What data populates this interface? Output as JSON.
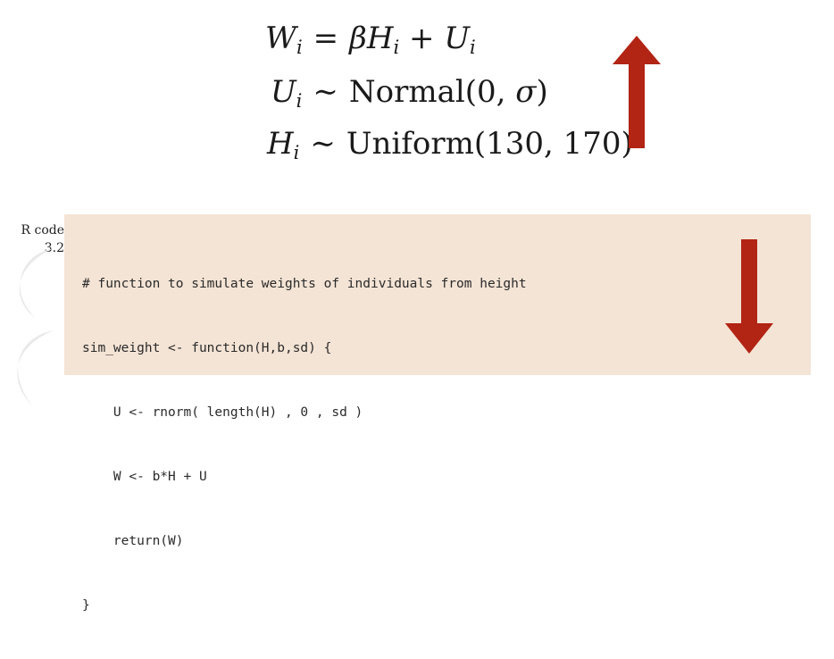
{
  "equations": [
    {
      "lhs": "W",
      "lhs_sub": "i",
      "op": "=",
      "parts": [
        {
          "text": "β",
          "italic": true
        },
        {
          "text": "H",
          "italic": true,
          "sub": "i"
        },
        {
          "text": " + ",
          "italic": false
        },
        {
          "text": "U",
          "italic": true,
          "sub": "i"
        }
      ]
    },
    {
      "lhs": "U",
      "lhs_sub": "i",
      "op": "∼",
      "parts": [
        {
          "text": "Normal(0, ",
          "italic": false
        },
        {
          "text": "σ",
          "italic": true
        },
        {
          "text": ")",
          "italic": false
        }
      ]
    },
    {
      "lhs": "H",
      "lhs_sub": "i",
      "op": "∼",
      "parts": [
        {
          "text": "Uniform(130, 170)",
          "italic": false
        }
      ]
    }
  ],
  "code_label": {
    "line1": "R code",
    "line2": "3.2"
  },
  "code": [
    "# function to simulate weights of individuals from height",
    "sim_weight <- function(H,b,sd) {",
    "    U <- rnorm( length(H) , 0 , sd )",
    "    W <- b*H + U",
    "    return(W)",
    "}"
  ],
  "arrows": {
    "up": {
      "direction": "up",
      "color": "#b22414"
    },
    "down": {
      "direction": "down",
      "color": "#b22414"
    }
  },
  "colors": {
    "code_background": "#f4e4d5",
    "arrow": "#b22414",
    "text": "#1a1a1a"
  }
}
